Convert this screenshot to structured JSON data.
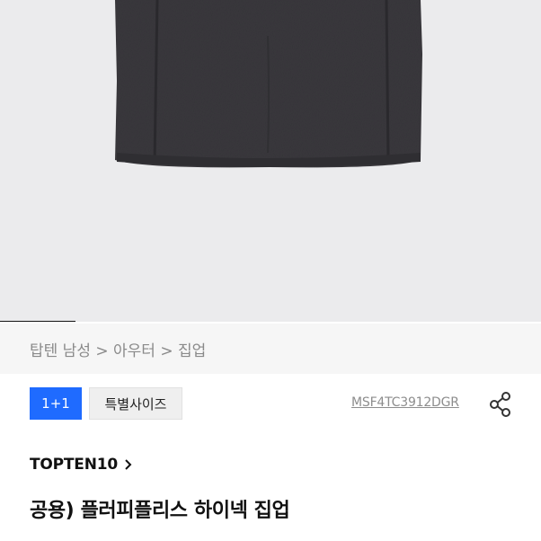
{
  "product_image": {
    "alt": "hoodie-image",
    "carousel_progress": 0.14
  },
  "breadcrumb": "탑텐 남성 > 아우터 > 집업",
  "badges": [
    {
      "label": "1+1",
      "color": "#1f6bff"
    },
    {
      "label": "특별사이즈",
      "color": "#efefef"
    }
  ],
  "sku": "MSF4TC3912DGR",
  "brand": "TOPTEN10",
  "title": "공용) 플러피플리스 하이넥 집업",
  "colors": {
    "accent": "#1f6bff",
    "text": "#111111",
    "muted": "#8a8a8a"
  }
}
